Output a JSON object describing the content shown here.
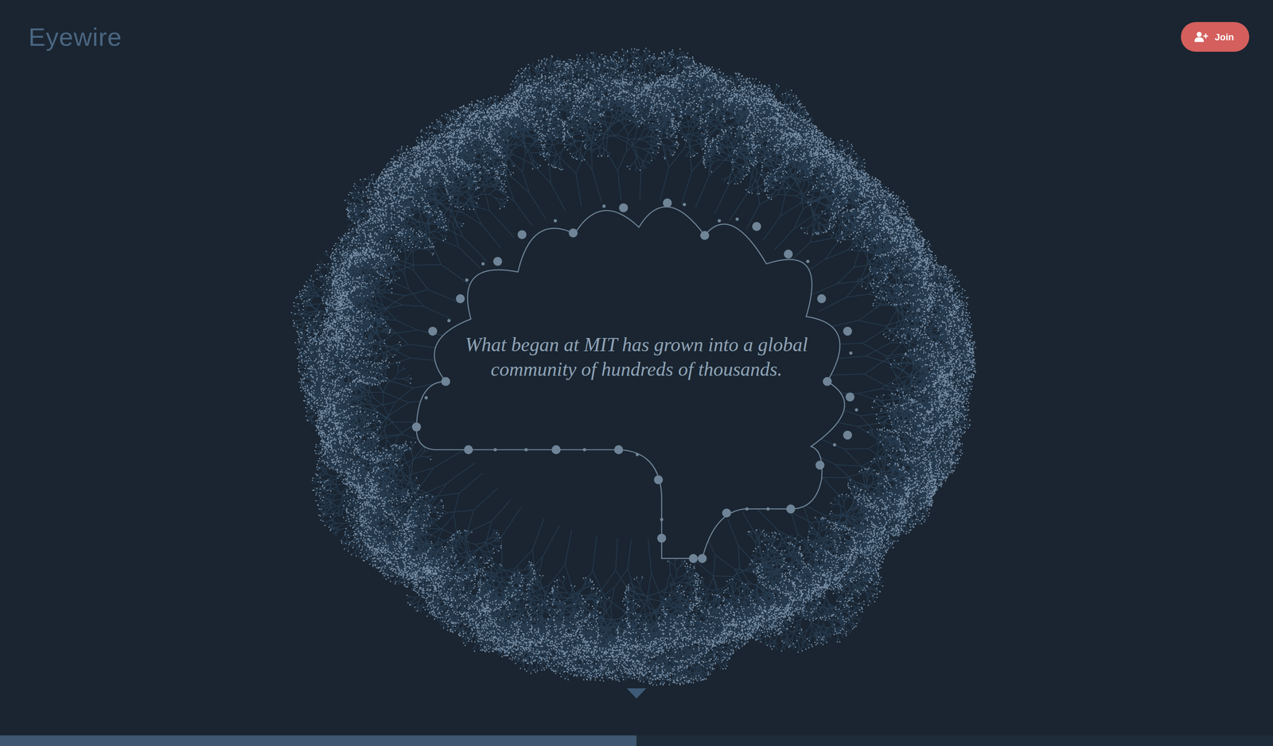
{
  "header": {
    "logo": "Eyewire",
    "join_button": {
      "label": "Join"
    }
  },
  "hero": {
    "lines": [
      "What began at MIT has grown into a global",
      "community of hundreds of thousands."
    ]
  },
  "progress": {
    "level": 0.5
  }
}
